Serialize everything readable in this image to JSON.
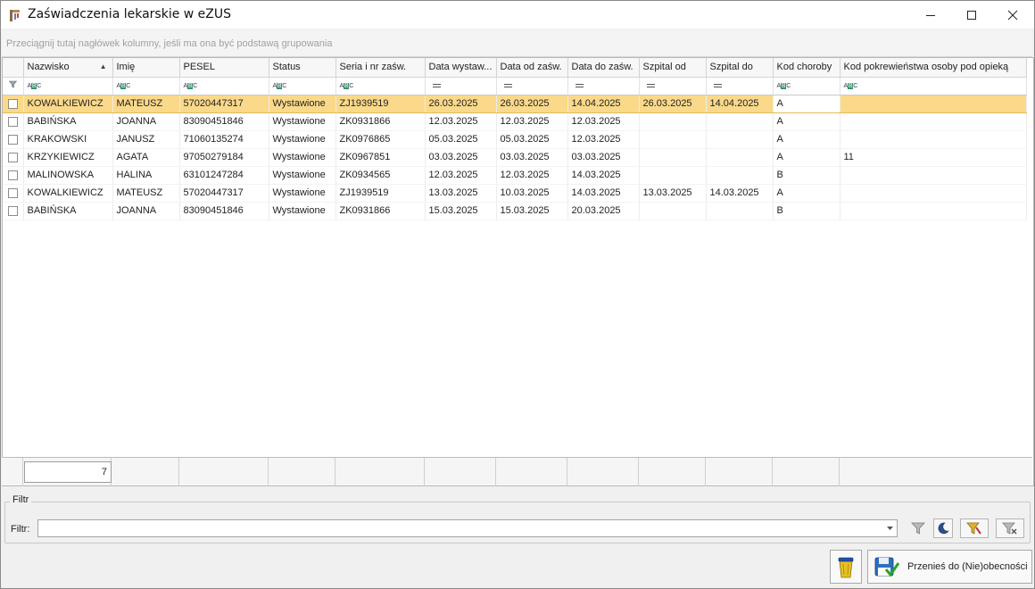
{
  "window": {
    "title": "Zaświadczenia lekarskie w eZUS",
    "controls": [
      "minimize",
      "maximize",
      "close"
    ]
  },
  "group_panel": {
    "hint": "Przeciągnij tutaj nagłówek kolumny, jeśli ma ona być podstawą grupowania"
  },
  "grid": {
    "columns": [
      {
        "key": "nazwisko",
        "label": "Nazwisko",
        "sorted": "asc",
        "filter": "text"
      },
      {
        "key": "imie",
        "label": "Imię",
        "filter": "text"
      },
      {
        "key": "pesel",
        "label": "PESEL",
        "filter": "text"
      },
      {
        "key": "status",
        "label": "Status",
        "filter": "text"
      },
      {
        "key": "seria",
        "label": "Seria i nr zaśw.",
        "filter": "text"
      },
      {
        "key": "data_wystawienia",
        "label": "Data wystaw...",
        "filter": "equals"
      },
      {
        "key": "data_od",
        "label": "Data od zaśw.",
        "filter": "equals"
      },
      {
        "key": "data_do",
        "label": "Data do zaśw.",
        "filter": "equals"
      },
      {
        "key": "szpital_od",
        "label": "Szpital od",
        "filter": "equals"
      },
      {
        "key": "szpital_do",
        "label": "Szpital do",
        "filter": "equals"
      },
      {
        "key": "kod_choroby",
        "label": "Kod choroby",
        "filter": "text"
      },
      {
        "key": "kod_pokrewienstwa",
        "label": "Kod pokrewieństwa osoby pod opieką",
        "filter": "text"
      }
    ],
    "rows": [
      [
        "KOWALKIEWICZ",
        "MATEUSZ",
        "57020447317",
        "Wystawione",
        "ZJ1939519",
        "26.03.2025",
        "26.03.2025",
        "14.04.2025",
        "26.03.2025",
        "14.04.2025",
        "A",
        ""
      ],
      [
        "BABIŃSKA",
        "JOANNA",
        "83090451846",
        "Wystawione",
        "ZK0931866",
        "12.03.2025",
        "12.03.2025",
        "12.03.2025",
        "",
        "",
        "A",
        ""
      ],
      [
        "KRAKOWSKI",
        "JANUSZ",
        "71060135274",
        "Wystawione",
        "ZK0976865",
        "05.03.2025",
        "05.03.2025",
        "12.03.2025",
        "",
        "",
        "A",
        ""
      ],
      [
        "KRZYKIEWICZ",
        "AGATA",
        "97050279184",
        "Wystawione",
        "ZK0967851",
        "03.03.2025",
        "03.03.2025",
        "03.03.2025",
        "",
        "",
        "A",
        "11"
      ],
      [
        "MALINOWSKA",
        "HALINA",
        "63101247284",
        "Wystawione",
        "ZK0934565",
        "12.03.2025",
        "12.03.2025",
        "14.03.2025",
        "",
        "",
        "B",
        ""
      ],
      [
        "KOWALKIEWICZ",
        "MATEUSZ",
        "57020447317",
        "Wystawione",
        "ZJ1939519",
        "13.03.2025",
        "10.03.2025",
        "14.03.2025",
        "13.03.2025",
        "14.03.2025",
        "A",
        ""
      ],
      [
        "BABIŃSKA",
        "JOANNA",
        "83090451846",
        "Wystawione",
        "ZK0931866",
        "15.03.2025",
        "15.03.2025",
        "20.03.2025",
        "",
        "",
        "B",
        ""
      ]
    ],
    "selected_row": 0,
    "footer_count": "7"
  },
  "filter": {
    "group_title": "Filtr",
    "label": "Filtr:",
    "value": ""
  },
  "actions": {
    "move_button_label": "Przenieś do (Nie)obecności"
  },
  "colors": {
    "selected_row": "#fbd98a",
    "grid_background": "#ffffff",
    "window_background": "#f0f0f0"
  }
}
